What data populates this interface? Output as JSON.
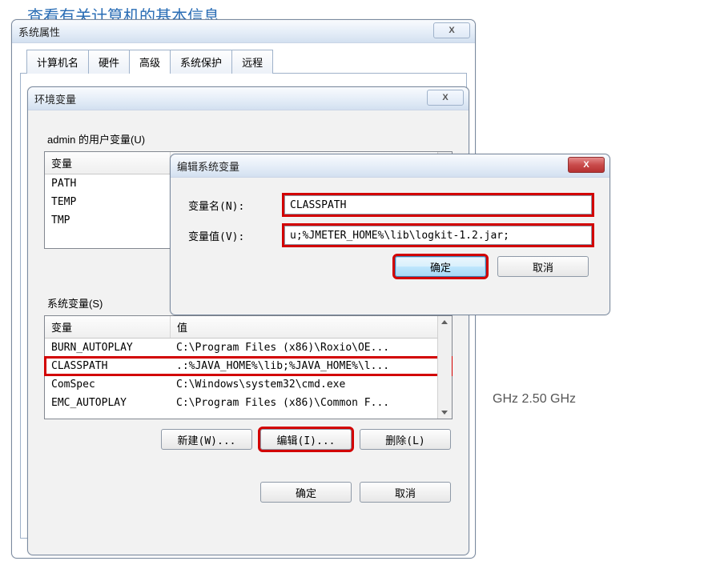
{
  "bg_heading": "查看有关计算机的基本信息",
  "bg_cpu": "GHz  2.50 GHz",
  "sysprops": {
    "title": "系统属性",
    "tabs": [
      "计算机名",
      "硬件",
      "高级",
      "系统保护",
      "远程"
    ],
    "active_tab": "高级"
  },
  "envvars": {
    "title": "环境变量",
    "user_group_label": "admin 的用户变量(U)",
    "sys_group_label": "系统变量(S)",
    "col_variable": "变量",
    "col_value": "值",
    "user_vars": [
      {
        "name": "PATH",
        "value": ""
      },
      {
        "name": "TEMP",
        "value": ""
      },
      {
        "name": "TMP",
        "value": ""
      }
    ],
    "sys_vars": [
      {
        "name": "BURN_AUTOPLAY",
        "value": "C:\\Program Files (x86)\\Roxio\\OE..."
      },
      {
        "name": "CLASSPATH",
        "value": ".:%JAVA_HOME%\\lib;%JAVA_HOME%\\l..."
      },
      {
        "name": "ComSpec",
        "value": "C:\\Windows\\system32\\cmd.exe"
      },
      {
        "name": "EMC_AUTOPLAY",
        "value": "C:\\Program Files (x86)\\Common F..."
      }
    ],
    "buttons": {
      "new": "新建(W)...",
      "edit": "编辑(I)...",
      "delete": "删除(L)"
    },
    "ok": "确定",
    "cancel": "取消"
  },
  "editdlg": {
    "title": "编辑系统变量",
    "name_label": "变量名(N):",
    "value_label": "变量值(V):",
    "name": "CLASSPATH",
    "value": "u;%JMETER_HOME%\\lib\\logkit-1.2.jar;",
    "ok": "确定",
    "cancel": "取消"
  }
}
